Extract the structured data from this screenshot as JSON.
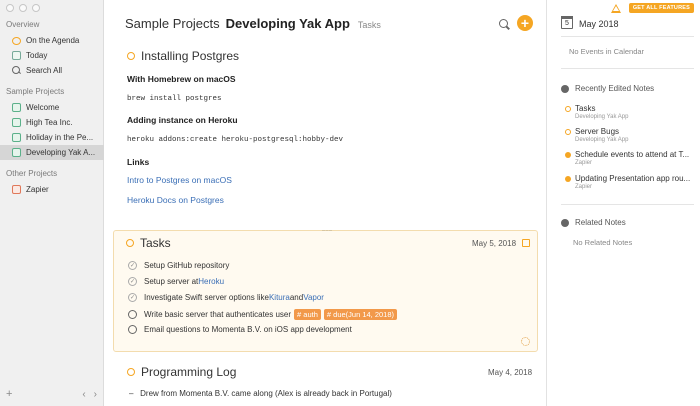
{
  "sidebar": {
    "overview_label": "Overview",
    "overview_items": [
      {
        "label": "On the Agenda",
        "icon": "agenda-icon"
      },
      {
        "label": "Today",
        "icon": "today-icon"
      },
      {
        "label": "Search All",
        "icon": "search-icon"
      }
    ],
    "sample_projects_label": "Sample Projects",
    "sample_projects": [
      {
        "label": "Welcome"
      },
      {
        "label": "High Tea Inc."
      },
      {
        "label": "Holiday in the Pe..."
      },
      {
        "label": "Developing Yak A...",
        "active": true
      }
    ],
    "other_projects_label": "Other Projects",
    "other_projects": [
      {
        "label": "Zapier"
      }
    ],
    "bottom": {
      "add": "+",
      "back": "‹",
      "forward": "›"
    }
  },
  "header": {
    "project": "Sample Projects",
    "title": "Developing Yak App",
    "section": "Tasks",
    "add_symbol": "+"
  },
  "note_postgres": {
    "title": "Installing Postgres",
    "h1": "With Homebrew on macOS",
    "code1": "brew install postgres",
    "h2": "Adding instance on Heroku",
    "code2": "heroku addons:create heroku-postgresql:hobby-dev",
    "h3": "Links",
    "link1": "Intro to Postgres on macOS",
    "link2": "Heroku Docs on Postgres"
  },
  "note_tasks": {
    "title": "Tasks",
    "date": "May 5, 2018",
    "items": [
      {
        "pre": "Setup GitHub repository",
        "done": true
      },
      {
        "pre": "Setup server at ",
        "link": "Heroku",
        "done": true
      },
      {
        "pre": "Investigate Swift server options like ",
        "link": "Kitura",
        "mid": " and ",
        "link2": "Vapor",
        "done": true
      },
      {
        "pre": "Write basic server that authenticates user",
        "tag1": "# auth",
        "tag2": "# due(Jun 14, 2018)",
        "done": false
      },
      {
        "pre": "Email questions to Momenta B.V. on iOS app development",
        "done": false
      }
    ]
  },
  "note_log": {
    "title": "Programming Log",
    "date": "May 4, 2018",
    "bullet": "Drew from Momenta B.V. came along (Alex is already back in Portugal)"
  },
  "right": {
    "pro_label": "GET ALL FEATURES",
    "cal_day": "5",
    "month": "May 2018",
    "no_events": "No Events in Calendar",
    "recent_label": "Recently Edited Notes",
    "recent": [
      {
        "title": "Tasks",
        "sub": "Developing Yak App",
        "filled": false
      },
      {
        "title": "Server Bugs",
        "sub": "Developing Yak App",
        "filled": false
      },
      {
        "title": "Schedule events to attend at T...",
        "sub": "Zapier",
        "filled": true
      },
      {
        "title": "Updating Presentation app rou...",
        "sub": "Zapier",
        "filled": true
      }
    ],
    "related_label": "Related Notes",
    "no_related": "No Related Notes"
  },
  "colors": {
    "accent": "#f5a623",
    "link": "#3b6fb6",
    "tag": "#f2994a"
  }
}
